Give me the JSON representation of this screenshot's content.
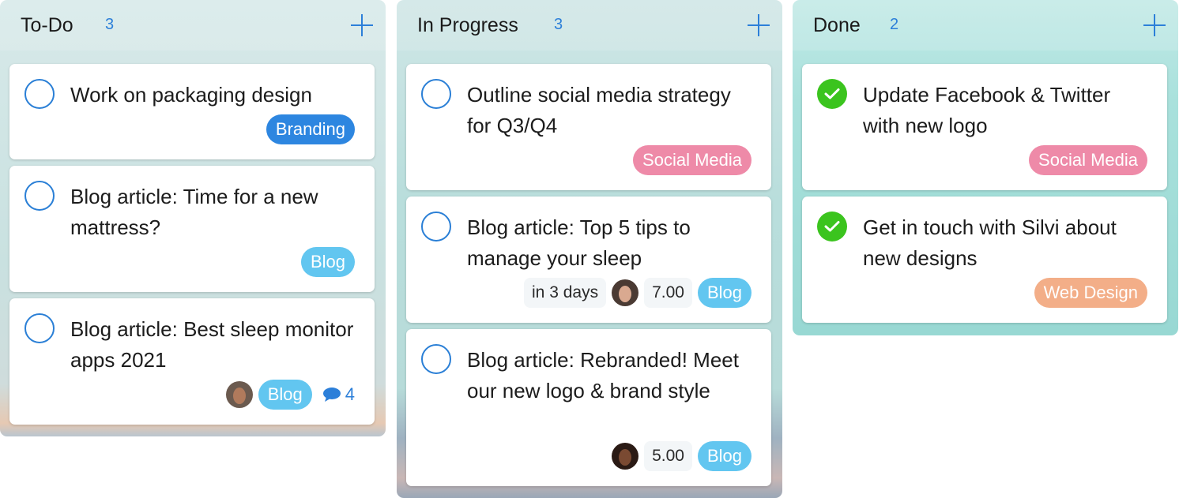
{
  "colors": {
    "accent": "#2c7fd9",
    "done_check": "#3bc41e",
    "tag_branding": "#2d86e0",
    "tag_blog": "#62c6f0",
    "tag_social_media": "#ee8aa8",
    "tag_web_design": "#f3ae88"
  },
  "columns": [
    {
      "title": "To-Do",
      "count": "3",
      "add_icon": "plus-icon",
      "cards": [
        {
          "title": "Work on packaging design",
          "completed": false,
          "tag": "Branding"
        },
        {
          "title": "Blog article: Time for a new mattress?",
          "completed": false,
          "tag": "Blog"
        },
        {
          "title": "Blog article: Best sleep monitor apps 2021",
          "completed": false,
          "tag": "Blog",
          "assignee_icon": "avatar-woman",
          "comments_icon": "speech-bubble-icon",
          "comments": "4"
        }
      ]
    },
    {
      "title": "In Progress",
      "count": "3",
      "add_icon": "plus-icon",
      "cards": [
        {
          "title": "Outline social media strategy for Q3/Q4",
          "completed": false,
          "tag": "Social Media"
        },
        {
          "title": "Blog article: Top 5 tips to manage your sleep",
          "completed": false,
          "due": "in 3 days",
          "assignee_icon": "avatar-woman",
          "estimate": "7.00",
          "tag": "Blog"
        },
        {
          "title": "Blog article: Rebranded! Meet our new logo & brand style",
          "completed": false,
          "assignee_icon": "avatar-woman",
          "estimate": "5.00",
          "tag": "Blog"
        }
      ]
    },
    {
      "title": "Done",
      "count": "2",
      "add_icon": "plus-icon",
      "cards": [
        {
          "title": "Update Facebook & Twitter with new logo",
          "completed": true,
          "tag": "Social Media"
        },
        {
          "title": "Get in touch with Silvi about new designs",
          "completed": true,
          "tag": "Web Design"
        }
      ]
    }
  ]
}
